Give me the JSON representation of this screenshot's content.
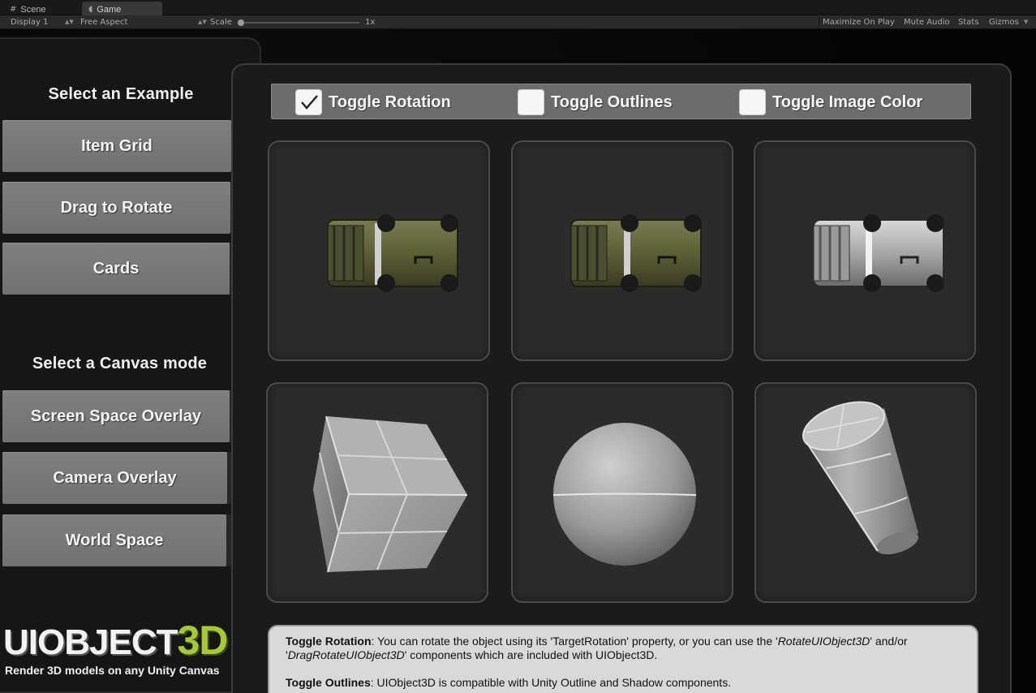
{
  "editor": {
    "tabs": [
      {
        "label": "Scene",
        "icon": "grid-icon"
      },
      {
        "label": "Game",
        "icon": "pacman-icon"
      }
    ],
    "toolbar": {
      "display": "Display 1",
      "aspect": "Free Aspect",
      "scale_label": "Scale",
      "scale_value": "1x",
      "scale_fraction": 0.0,
      "maximize": "Maximize On Play",
      "mute": "Mute Audio",
      "stats": "Stats",
      "gizmos": "Gizmos"
    }
  },
  "sidebar": {
    "example_title": "Select an Example",
    "examples": [
      "Item Grid",
      "Drag to Rotate",
      "Cards"
    ],
    "canvas_title": "Select a Canvas mode",
    "canvas_modes": [
      "Screen Space Overlay",
      "Camera Overlay",
      "World Space"
    ],
    "logo": {
      "main": "UIOBJECT",
      "accent": "3D",
      "tagline": "Render 3D models on any Unity Canvas"
    }
  },
  "toggles": [
    {
      "label": "Toggle Rotation",
      "checked": true
    },
    {
      "label": "Toggle Outlines",
      "checked": false
    },
    {
      "label": "Toggle Image Color",
      "checked": false
    }
  ],
  "grid": {
    "items": [
      {
        "model": "crate-camo"
      },
      {
        "model": "crate-camo"
      },
      {
        "model": "crate-silver"
      },
      {
        "model": "cube"
      },
      {
        "model": "sphere"
      },
      {
        "model": "cylinder"
      }
    ]
  },
  "description": {
    "rotation_title": "Toggle Rotation",
    "rotation_1": ": You can rotate the object using its 'TargetRotation' property, or you can use the '",
    "rotation_2": "RotateUIObject3D",
    "rotation_3": "' and/or '",
    "rotation_4": "DragRotateUIObject3D",
    "rotation_5": "' components which are included with UIObject3D.",
    "outlines_title": "Toggle Outlines",
    "outlines_text": ": UIObject3D is compatible with Unity Outline and Shadow components."
  },
  "colors": {
    "accent_green": "#a6c83a",
    "button_gray": "#7a7a7a",
    "panel_dark": "#1b1b1b"
  }
}
